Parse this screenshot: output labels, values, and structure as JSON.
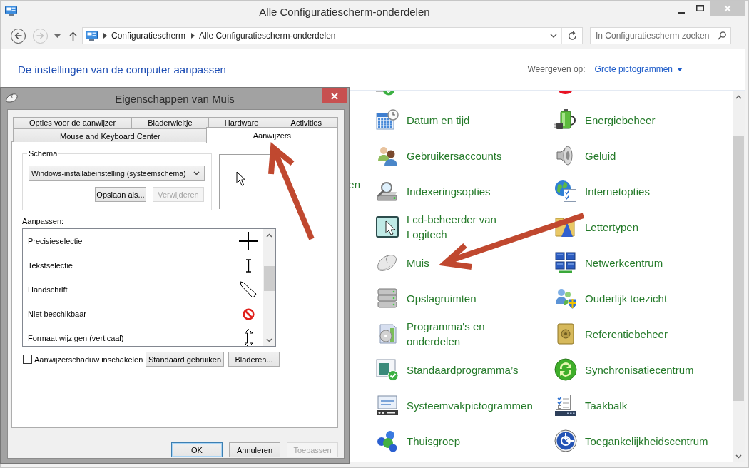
{
  "window": {
    "title": "Alle Configuratiescherm-onderdelen"
  },
  "navigation": {
    "back": {
      "disabled": false
    },
    "forward": {
      "disabled": true
    },
    "breadcrumbs": [
      "Configuratiescherm",
      "Alle Configuratiescherm-onderdelen"
    ],
    "search": {
      "placeholder": "In Configuratiescherm zoeken"
    }
  },
  "header": {
    "title": "De instellingen van de computer aanpassen",
    "view_label": "Weergeven op:",
    "view_value": "Grote pictogrammen"
  },
  "item_grid": {
    "fragment": "en",
    "items": [
      {
        "label": "Datum en tijd"
      },
      {
        "label": "Energiebeheer"
      },
      {
        "label": "Gebruikersaccounts"
      },
      {
        "label": "Geluid"
      },
      {
        "label": "Indexeringsopties"
      },
      {
        "label": "Internetopties"
      },
      {
        "label": "Lcd-beheerder van\nLogitech"
      },
      {
        "label": "Lettertypen"
      },
      {
        "label": "Muis"
      },
      {
        "label": "Netwerkcentrum"
      },
      {
        "label": "Opslagruimten"
      },
      {
        "label": "Ouderlijk toezicht"
      },
      {
        "label": "Programma's en\nonderdelen"
      },
      {
        "label": "Referentiebeheer"
      },
      {
        "label": "Standaardprogramma’s"
      },
      {
        "label": "Synchronisatiecentrum"
      },
      {
        "label": "Systeemvakpictogrammen"
      },
      {
        "label": "Taakbalk"
      },
      {
        "label": "Thuisgroep"
      },
      {
        "label": "Toegankelijkheidscentrum"
      }
    ]
  },
  "dialog": {
    "title": "Eigenschappen van Muis",
    "tab_rows": [
      {
        "tabs": [
          {
            "label": "Opties voor de aanwijzer",
            "selected": false
          },
          {
            "label": "Bladerwieltje",
            "selected": false
          },
          {
            "label": "Hardware",
            "selected": false
          },
          {
            "label": "Activities",
            "selected": false
          }
        ]
      },
      {
        "tabs": [
          {
            "label": "Mouse and Keyboard Center",
            "selected": false
          },
          {
            "label": "Aanwijzers",
            "selected": true
          }
        ]
      }
    ],
    "scheme": {
      "group_label": "Schema",
      "value": "Windows-installatieinstelling (systeemschema)",
      "buttons": [
        {
          "label": "Opslaan als...",
          "disabled": false
        },
        {
          "label": "Verwijderen",
          "disabled": true
        }
      ]
    },
    "customize": {
      "label": "Aanpassen:",
      "pointers": [
        {
          "name": "Precisieselectie",
          "selected": false
        },
        {
          "name": "Tekstselectie",
          "selected": false
        },
        {
          "name": "Handschrift",
          "selected": false
        },
        {
          "name": "Niet beschikbaar",
          "selected": false
        },
        {
          "name": "Formaat wijzigen (verticaal)",
          "selected": false
        }
      ]
    },
    "shadow": {
      "label": "Aanwijzerschaduw inschakelen",
      "checked": false
    },
    "pointer_buttons": [
      {
        "label": "Standaard gebruiken",
        "disabled": false
      },
      {
        "label": "Bladeren...",
        "disabled": false
      }
    ],
    "footer_buttons": [
      {
        "label": "OK",
        "default": true,
        "disabled": false
      },
      {
        "label": "Annuleren",
        "default": false,
        "disabled": false
      },
      {
        "label": "Toepassen",
        "default": false,
        "disabled": true
      }
    ]
  }
}
